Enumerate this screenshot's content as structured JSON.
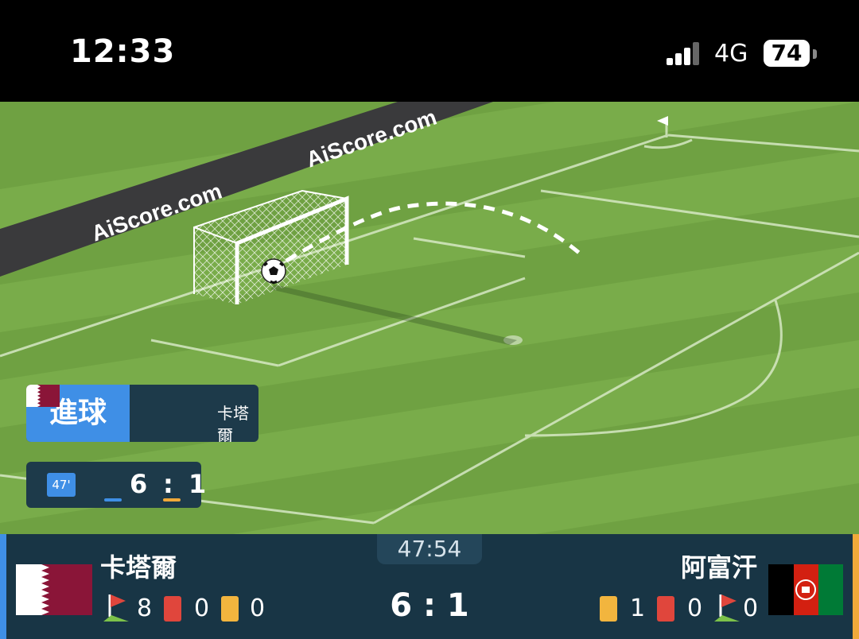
{
  "status_bar": {
    "time": "12:33",
    "network": "4G",
    "battery": "74"
  },
  "pitch": {
    "board_text_1": "AiScore.com",
    "board_text_2": "AiScore.com"
  },
  "event": {
    "type": "進球",
    "team": "卡塔爾",
    "minute": "47'",
    "home_score": "6",
    "away_score": "1",
    "colon": ":"
  },
  "match": {
    "clock": "47:54",
    "score": "6 : 1",
    "home": {
      "name": "卡塔爾",
      "corners": "8",
      "red_cards": "0",
      "yellow_cards": "0"
    },
    "away": {
      "name": "阿富汗",
      "yellow_cards": "1",
      "red_cards": "0",
      "corners": "0"
    }
  },
  "colors": {
    "home": "#3f8fe6",
    "away": "#f0a93a",
    "pitch": "#6fa142",
    "panel": "#183545"
  }
}
